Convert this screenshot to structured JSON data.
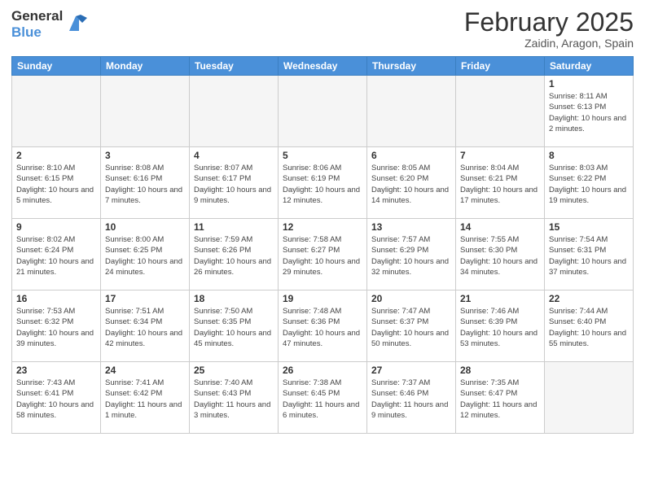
{
  "header": {
    "logo_general": "General",
    "logo_blue": "Blue",
    "month_title": "February 2025",
    "location": "Zaidin, Aragon, Spain"
  },
  "days_of_week": [
    "Sunday",
    "Monday",
    "Tuesday",
    "Wednesday",
    "Thursday",
    "Friday",
    "Saturday"
  ],
  "weeks": [
    [
      {
        "day": "",
        "info": ""
      },
      {
        "day": "",
        "info": ""
      },
      {
        "day": "",
        "info": ""
      },
      {
        "day": "",
        "info": ""
      },
      {
        "day": "",
        "info": ""
      },
      {
        "day": "",
        "info": ""
      },
      {
        "day": "1",
        "info": "Sunrise: 8:11 AM\nSunset: 6:13 PM\nDaylight: 10 hours and 2 minutes."
      }
    ],
    [
      {
        "day": "2",
        "info": "Sunrise: 8:10 AM\nSunset: 6:15 PM\nDaylight: 10 hours and 5 minutes."
      },
      {
        "day": "3",
        "info": "Sunrise: 8:08 AM\nSunset: 6:16 PM\nDaylight: 10 hours and 7 minutes."
      },
      {
        "day": "4",
        "info": "Sunrise: 8:07 AM\nSunset: 6:17 PM\nDaylight: 10 hours and 9 minutes."
      },
      {
        "day": "5",
        "info": "Sunrise: 8:06 AM\nSunset: 6:19 PM\nDaylight: 10 hours and 12 minutes."
      },
      {
        "day": "6",
        "info": "Sunrise: 8:05 AM\nSunset: 6:20 PM\nDaylight: 10 hours and 14 minutes."
      },
      {
        "day": "7",
        "info": "Sunrise: 8:04 AM\nSunset: 6:21 PM\nDaylight: 10 hours and 17 minutes."
      },
      {
        "day": "8",
        "info": "Sunrise: 8:03 AM\nSunset: 6:22 PM\nDaylight: 10 hours and 19 minutes."
      }
    ],
    [
      {
        "day": "9",
        "info": "Sunrise: 8:02 AM\nSunset: 6:24 PM\nDaylight: 10 hours and 21 minutes."
      },
      {
        "day": "10",
        "info": "Sunrise: 8:00 AM\nSunset: 6:25 PM\nDaylight: 10 hours and 24 minutes."
      },
      {
        "day": "11",
        "info": "Sunrise: 7:59 AM\nSunset: 6:26 PM\nDaylight: 10 hours and 26 minutes."
      },
      {
        "day": "12",
        "info": "Sunrise: 7:58 AM\nSunset: 6:27 PM\nDaylight: 10 hours and 29 minutes."
      },
      {
        "day": "13",
        "info": "Sunrise: 7:57 AM\nSunset: 6:29 PM\nDaylight: 10 hours and 32 minutes."
      },
      {
        "day": "14",
        "info": "Sunrise: 7:55 AM\nSunset: 6:30 PM\nDaylight: 10 hours and 34 minutes."
      },
      {
        "day": "15",
        "info": "Sunrise: 7:54 AM\nSunset: 6:31 PM\nDaylight: 10 hours and 37 minutes."
      }
    ],
    [
      {
        "day": "16",
        "info": "Sunrise: 7:53 AM\nSunset: 6:32 PM\nDaylight: 10 hours and 39 minutes."
      },
      {
        "day": "17",
        "info": "Sunrise: 7:51 AM\nSunset: 6:34 PM\nDaylight: 10 hours and 42 minutes."
      },
      {
        "day": "18",
        "info": "Sunrise: 7:50 AM\nSunset: 6:35 PM\nDaylight: 10 hours and 45 minutes."
      },
      {
        "day": "19",
        "info": "Sunrise: 7:48 AM\nSunset: 6:36 PM\nDaylight: 10 hours and 47 minutes."
      },
      {
        "day": "20",
        "info": "Sunrise: 7:47 AM\nSunset: 6:37 PM\nDaylight: 10 hours and 50 minutes."
      },
      {
        "day": "21",
        "info": "Sunrise: 7:46 AM\nSunset: 6:39 PM\nDaylight: 10 hours and 53 minutes."
      },
      {
        "day": "22",
        "info": "Sunrise: 7:44 AM\nSunset: 6:40 PM\nDaylight: 10 hours and 55 minutes."
      }
    ],
    [
      {
        "day": "23",
        "info": "Sunrise: 7:43 AM\nSunset: 6:41 PM\nDaylight: 10 hours and 58 minutes."
      },
      {
        "day": "24",
        "info": "Sunrise: 7:41 AM\nSunset: 6:42 PM\nDaylight: 11 hours and 1 minute."
      },
      {
        "day": "25",
        "info": "Sunrise: 7:40 AM\nSunset: 6:43 PM\nDaylight: 11 hours and 3 minutes."
      },
      {
        "day": "26",
        "info": "Sunrise: 7:38 AM\nSunset: 6:45 PM\nDaylight: 11 hours and 6 minutes."
      },
      {
        "day": "27",
        "info": "Sunrise: 7:37 AM\nSunset: 6:46 PM\nDaylight: 11 hours and 9 minutes."
      },
      {
        "day": "28",
        "info": "Sunrise: 7:35 AM\nSunset: 6:47 PM\nDaylight: 11 hours and 12 minutes."
      },
      {
        "day": "",
        "info": ""
      }
    ]
  ]
}
